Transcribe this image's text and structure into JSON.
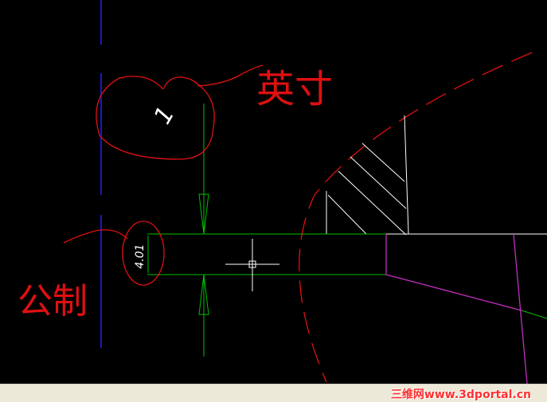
{
  "dimensions": {
    "inch_value": "1",
    "metric_value": "4.01"
  },
  "annotations": {
    "inch_label": "英寸",
    "metric_label": "公制"
  },
  "watermark": "三维网www.3dportal.cn",
  "colors": {
    "background": "#000000",
    "dimension": "#00c000",
    "annotation": "#e01010",
    "layer_magenta": "#c030c0",
    "axis_blue": "#1010c0",
    "geometry": "#ffffff"
  }
}
